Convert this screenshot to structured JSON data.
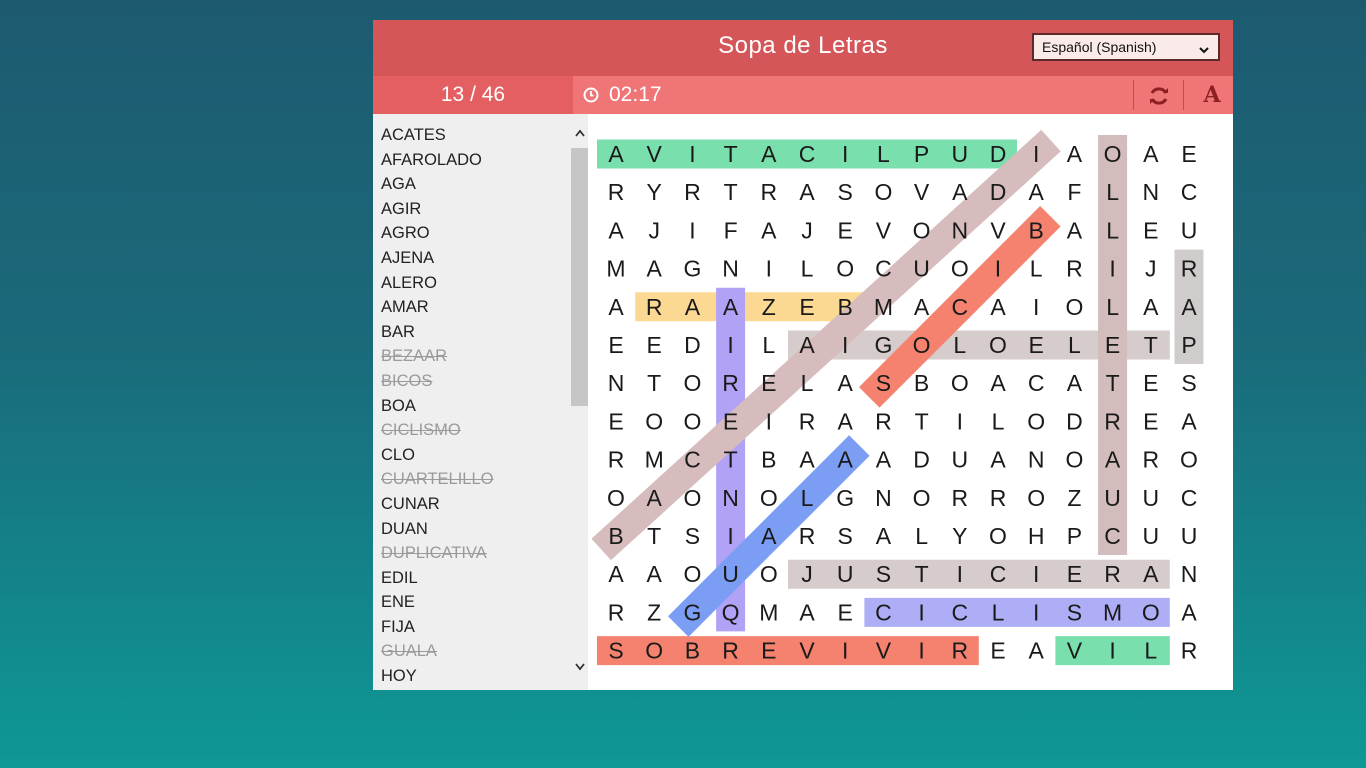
{
  "header": {
    "title": "Sopa de Letras",
    "language": "Español (Spanish)"
  },
  "progress": {
    "count": "13 / 46"
  },
  "timer": {
    "time": "02:17"
  },
  "toolbar": {
    "font_glyph": "A"
  },
  "word_list": [
    {
      "word": "ACATES",
      "found": false
    },
    {
      "word": "AFAROLADO",
      "found": false
    },
    {
      "word": "AGA",
      "found": false
    },
    {
      "word": "AGIR",
      "found": false
    },
    {
      "word": "AGRO",
      "found": false
    },
    {
      "word": "AJENA",
      "found": false
    },
    {
      "word": "ALERO",
      "found": false
    },
    {
      "word": "AMAR",
      "found": false
    },
    {
      "word": "BAR",
      "found": false
    },
    {
      "word": "BEZAAR",
      "found": true
    },
    {
      "word": "BICOS",
      "found": true
    },
    {
      "word": "BOA",
      "found": false
    },
    {
      "word": "CICLISMO",
      "found": true
    },
    {
      "word": "CLO",
      "found": false
    },
    {
      "word": "CUARTELILLO",
      "found": true
    },
    {
      "word": "CUNAR",
      "found": false
    },
    {
      "word": "DUAN",
      "found": false
    },
    {
      "word": "DUPLICATIVA",
      "found": true
    },
    {
      "word": "EDIL",
      "found": false
    },
    {
      "word": "ENE",
      "found": false
    },
    {
      "word": "FIJA",
      "found": false
    },
    {
      "word": "GUALA",
      "found": true
    },
    {
      "word": "HOY",
      "found": false
    }
  ],
  "grid": [
    "AVITACILPUDIAOAE",
    "RYRTRASOVADAFLNC",
    "AJIFAJEVONVBALEU",
    "MAGNILOCUOILRIJR",
    "ARAAZEBMACAIOLAA",
    "EEDILAIGOLOELETP",
    "NTORELASBOACATES",
    "EOOEIRARTILODREA",
    "RMCTBAAADUANOARO",
    "OAONOLGNORROZUUC",
    "BTSIARSALYOHPCUU",
    "AAOUOJUSTICIERAN",
    "RZGQMAECICLISMOA",
    "SOBREVIVIREAVILR"
  ],
  "highlights": [
    {
      "from": [
        0,
        0
      ],
      "to": [
        0,
        10
      ],
      "color": "#78dfad"
    },
    {
      "from": [
        13,
        0
      ],
      "to": [
        13,
        9
      ],
      "color": "#f4826f"
    },
    {
      "from": [
        13,
        12
      ],
      "to": [
        13,
        14
      ],
      "color": "#78dfad"
    },
    {
      "from": [
        4,
        1
      ],
      "to": [
        4,
        6
      ],
      "color": "#fbd992"
    },
    {
      "from": [
        5,
        5
      ],
      "to": [
        5,
        14
      ],
      "color": "#d7cccc"
    },
    {
      "from": [
        11,
        5
      ],
      "to": [
        11,
        14
      ],
      "color": "#d7cccc"
    },
    {
      "from": [
        12,
        7
      ],
      "to": [
        12,
        14
      ],
      "color": "#aeaef6"
    },
    {
      "from": [
        4,
        3
      ],
      "to": [
        12,
        3
      ],
      "color": "#b2a2f6"
    },
    {
      "from": [
        0,
        13
      ],
      "to": [
        10,
        13
      ],
      "color": "#d2bcbc"
    },
    {
      "from": [
        3,
        15
      ],
      "to": [
        5,
        15
      ],
      "color": "#d0cccc"
    },
    {
      "from": [
        10,
        0
      ],
      "to": [
        0,
        11
      ],
      "color": "#d6bcbc"
    },
    {
      "from": [
        6,
        7
      ],
      "to": [
        2,
        11
      ],
      "color": "#f4826f"
    },
    {
      "from": [
        12,
        2
      ],
      "to": [
        8,
        6
      ],
      "color": "#7b9ef4"
    }
  ]
}
